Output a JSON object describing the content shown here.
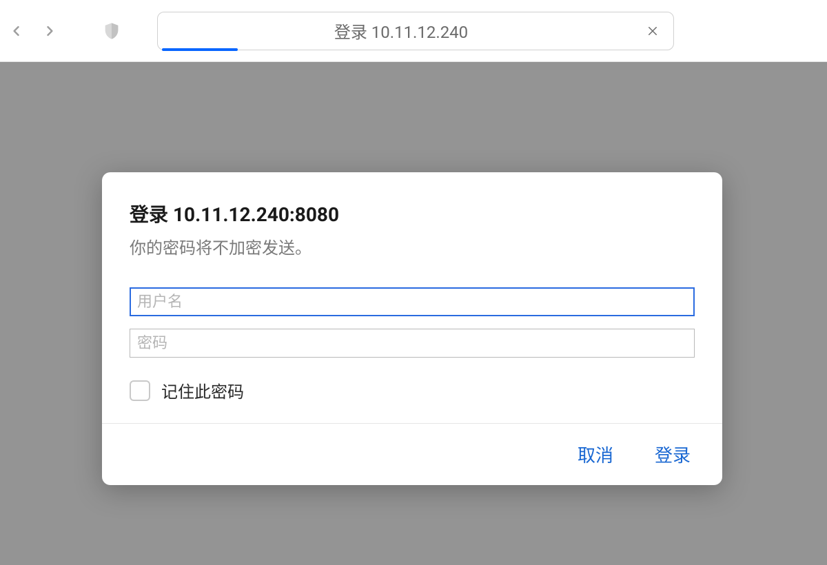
{
  "toolbar": {
    "address_text": "登录 10.11.12.240"
  },
  "dialog": {
    "title": "登录 10.11.12.240:8080",
    "subtitle": "你的密码将不加密发送。",
    "username_placeholder": "用户名",
    "password_placeholder": "密码",
    "remember_label": "记住此密码",
    "cancel_label": "取消",
    "login_label": "登录"
  }
}
